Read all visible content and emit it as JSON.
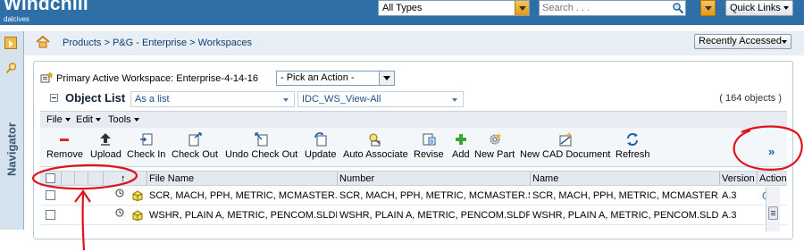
{
  "header": {
    "brand": "Windchill",
    "user": "dalcives",
    "type_filter": "All Types",
    "search_placeholder": "Search . . .",
    "quick_links": "Quick Links"
  },
  "navigator": {
    "label": "Navigator"
  },
  "breadcrumb": {
    "path": "Products > P&G - Enterprise > Workspaces",
    "recently_accessed": "Recently Accessed"
  },
  "workspace": {
    "title": "Primary Active Workspace: Enterprise-4-14-16",
    "action_select": "- Pick an Action -"
  },
  "object_list": {
    "title": "Object List",
    "view_mode": "As a list",
    "table_view": "IDC_WS_View-All",
    "count": "( 164 objects )"
  },
  "menus": [
    {
      "label": "File"
    },
    {
      "label": "Edit"
    },
    {
      "label": "Tools"
    }
  ],
  "toolbar": [
    {
      "label": "Remove",
      "icon": "remove-icon"
    },
    {
      "label": "Upload",
      "icon": "upload-icon"
    },
    {
      "label": "Check In",
      "icon": "check-in-icon"
    },
    {
      "label": "Check Out",
      "icon": "check-out-icon"
    },
    {
      "label": "Undo Check Out",
      "icon": "undo-check-out-icon"
    },
    {
      "label": "Update",
      "icon": "update-icon"
    },
    {
      "label": "Auto Associate",
      "icon": "auto-associate-icon"
    },
    {
      "label": "Revise",
      "icon": "revise-icon"
    },
    {
      "label": "Add",
      "icon": "add-icon"
    },
    {
      "label": "New Part",
      "icon": "new-part-icon"
    },
    {
      "label": "New CAD Document",
      "icon": "new-cad-document-icon"
    },
    {
      "label": "Refresh",
      "icon": "refresh-icon"
    }
  ],
  "more_actions": "»",
  "table": {
    "columns": [
      "File Name",
      "Number",
      "Name",
      "Version",
      "Action"
    ],
    "sort_indicator": "↑",
    "rows": [
      {
        "file_name": "SCR, MACH, PPH, METRIC, MCMASTER.SLDPRT",
        "number": "SCR, MACH, PPH, METRIC, MCMASTER.SLDPRT",
        "name": "SCR, MACH, PPH, METRIC, MCMASTER.SLDPRT",
        "version": "A.3"
      },
      {
        "file_name": "WSHR, PLAIN A, METRIC, PENCOM.SLDPRT",
        "number": "WSHR, PLAIN A, METRIC, PENCOM.SLDPRT",
        "name": "WSHR, PLAIN A, METRIC, PENCOM.SLDPRT",
        "version": "A.3"
      }
    ]
  },
  "colors": {
    "header_bg": "#2d6fa6",
    "annotation": "#e0121c"
  }
}
